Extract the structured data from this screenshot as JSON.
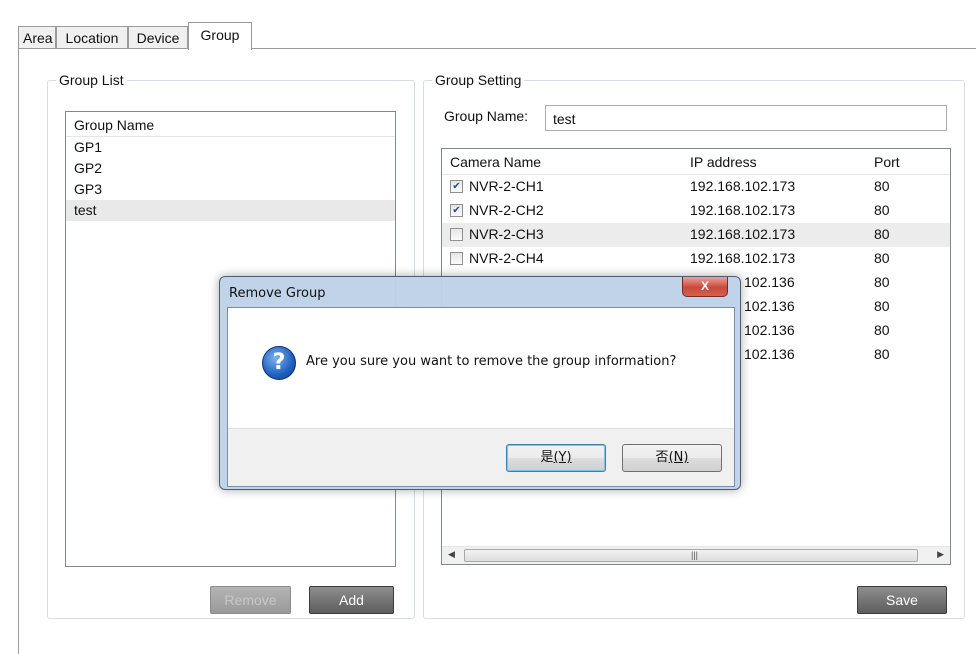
{
  "tabs": [
    {
      "label": "Area"
    },
    {
      "label": "Location"
    },
    {
      "label": "Device"
    },
    {
      "label": "Group"
    }
  ],
  "group_list": {
    "title": "Group List",
    "header": "Group Name",
    "items": [
      "GP1",
      "GP2",
      "GP3",
      "test"
    ],
    "selected": "test",
    "remove_label": "Remove",
    "add_label": "Add"
  },
  "group_setting": {
    "title": "Group Setting",
    "name_label": "Group Name:",
    "name_value": "test",
    "columns": {
      "camera": "Camera Name",
      "ip": "IP address",
      "port": "Port"
    },
    "rows": [
      {
        "camera": "NVR-2-CH1",
        "ip": "192.168.102.173",
        "port": "80",
        "checked": true
      },
      {
        "camera": "NVR-2-CH2",
        "ip": "192.168.102.173",
        "port": "80",
        "checked": true
      },
      {
        "camera": "NVR-2-CH3",
        "ip": "192.168.102.173",
        "port": "80",
        "checked": false
      },
      {
        "camera": "NVR-2-CH4",
        "ip": "192.168.102.173",
        "port": "80",
        "checked": false
      },
      {
        "camera": "",
        "ip": "102.136",
        "port": "80",
        "checked": false
      },
      {
        "camera": "",
        "ip": "102.136",
        "port": "80",
        "checked": false
      },
      {
        "camera": "",
        "ip": "102.136",
        "port": "80",
        "checked": false
      },
      {
        "camera": "",
        "ip": "102.136",
        "port": "80",
        "checked": false
      }
    ],
    "save_label": "Save"
  },
  "dialog": {
    "title": "Remove Group",
    "message": "Are you sure you want to remove the group information?",
    "close_glyph": "X",
    "yes_text": "是",
    "yes_key": "(Y)",
    "no_text": "否",
    "no_key": "(N)",
    "icon": "question-icon"
  },
  "colors": {
    "button_dark": "#5d5d5d",
    "dialog_frame": "#bed2e8",
    "close_red": "#c9493c",
    "selection": "#e9e9e9"
  }
}
